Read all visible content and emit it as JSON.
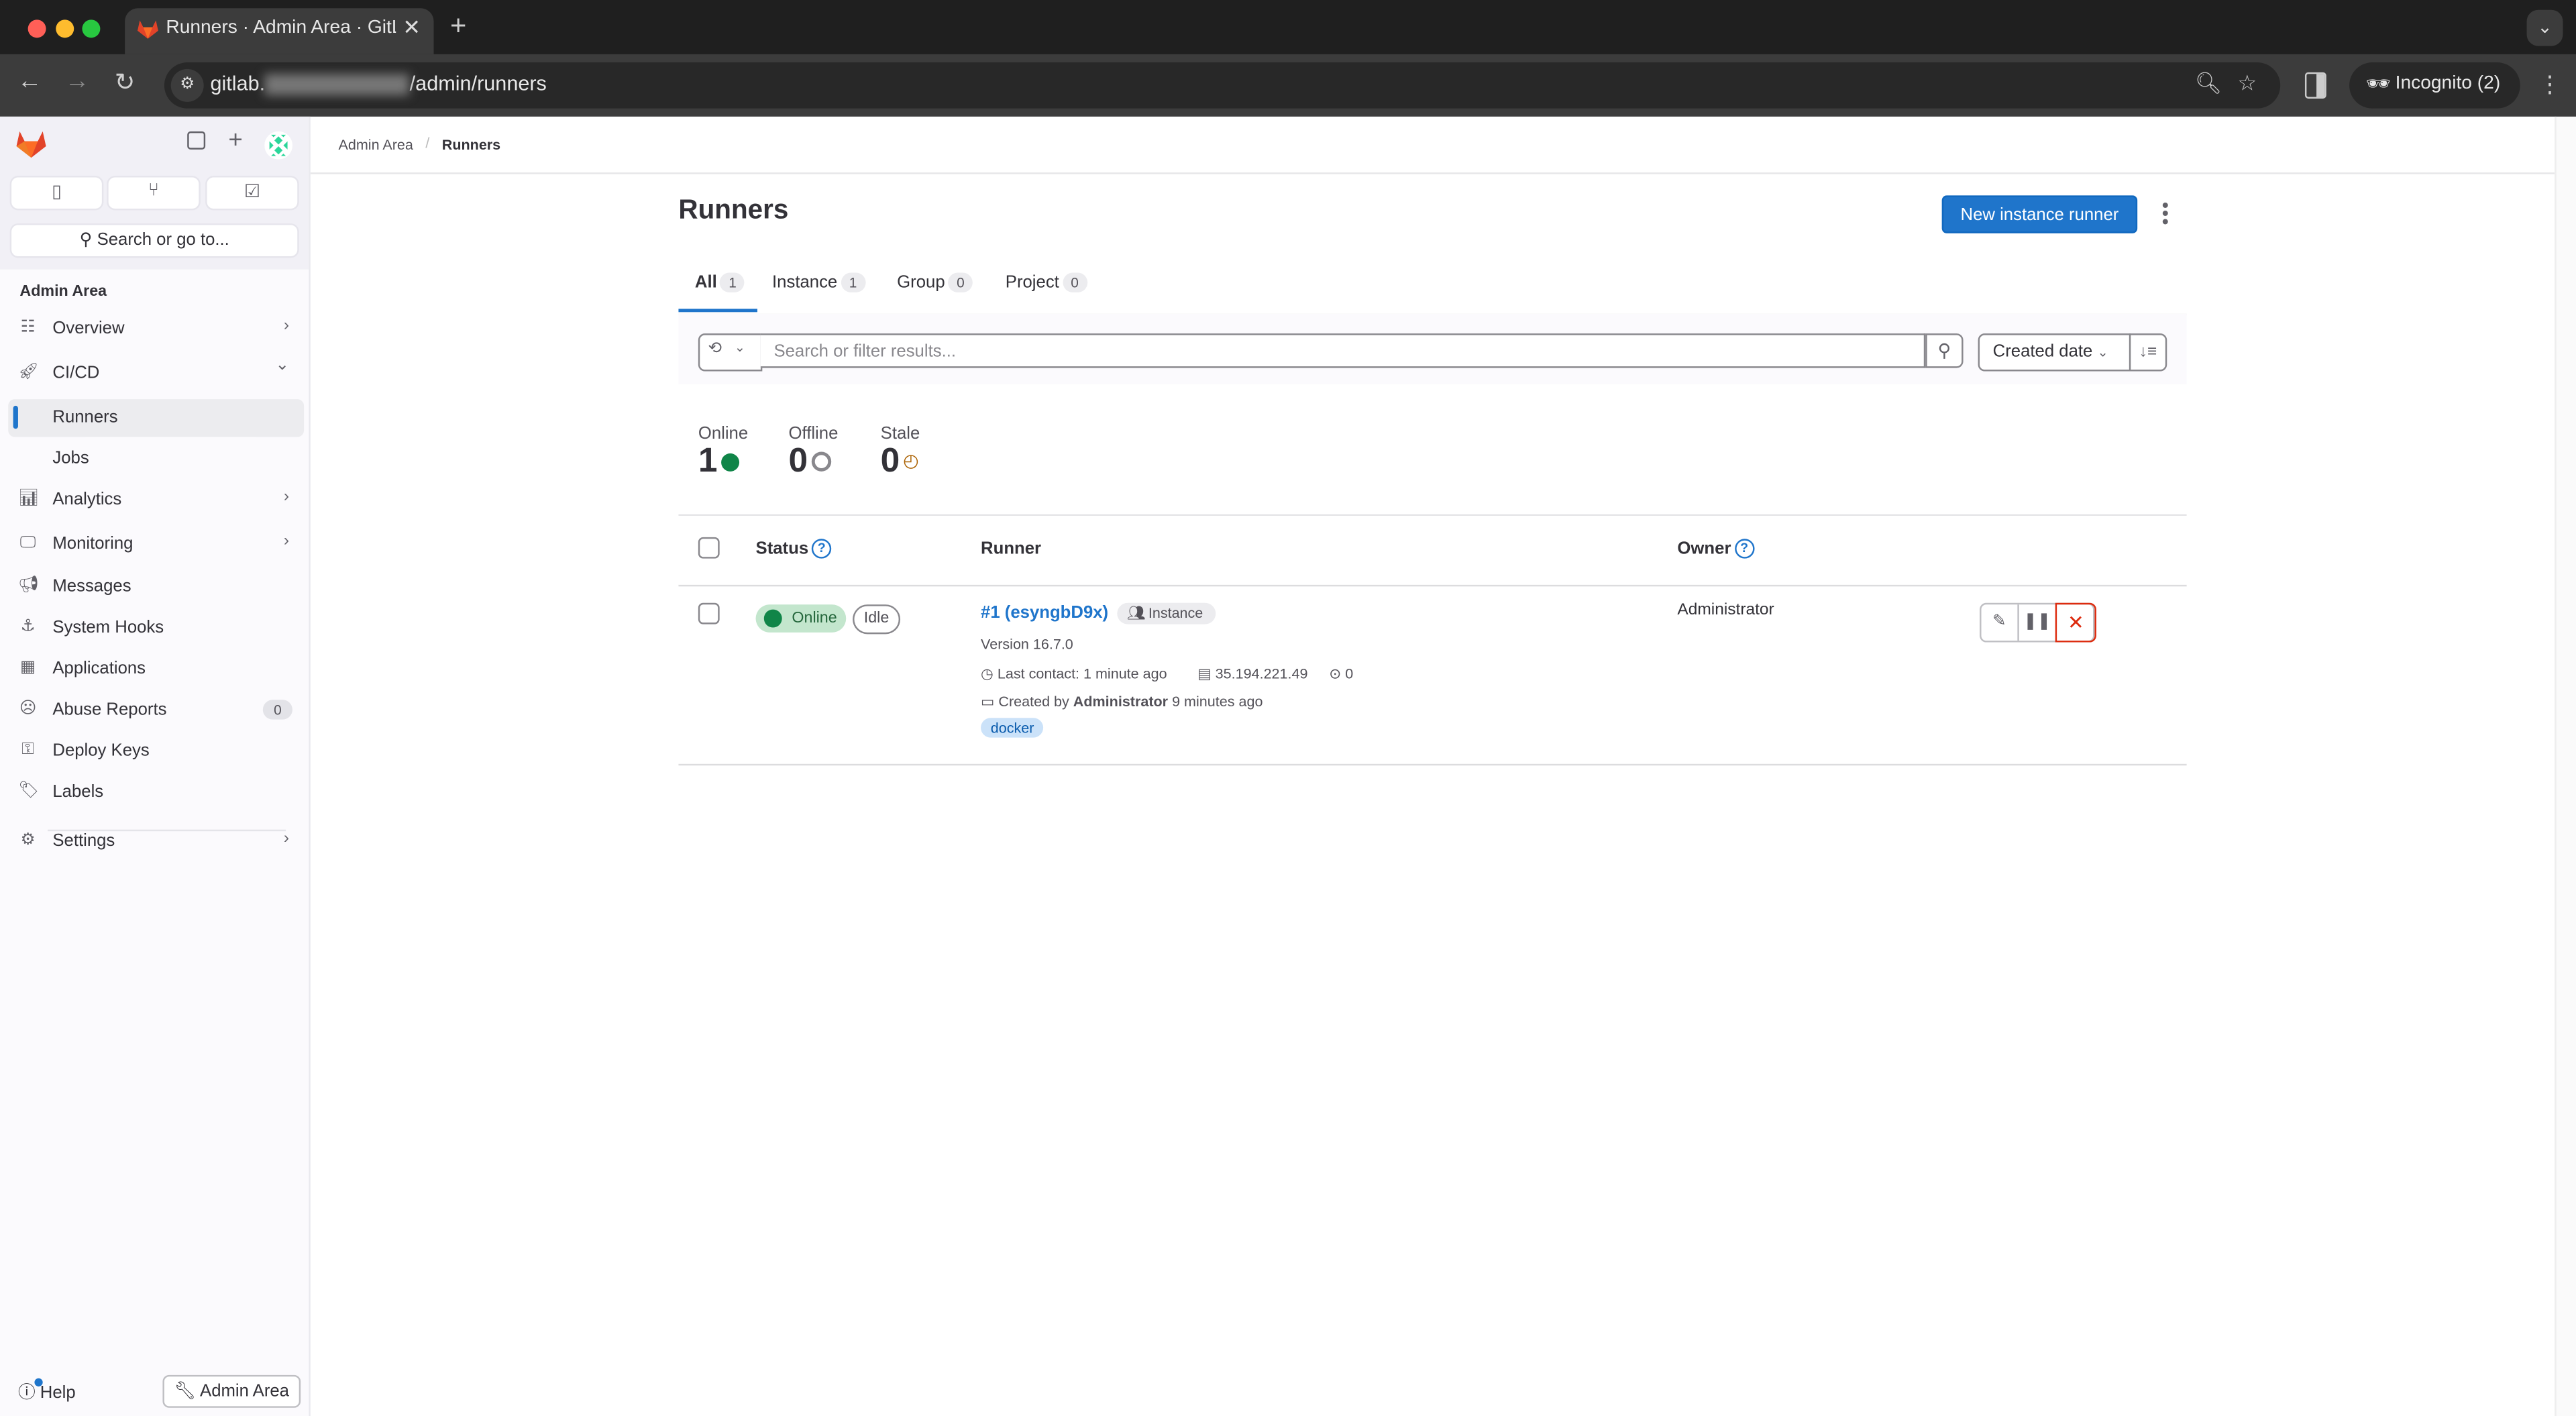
{
  "browser": {
    "tab_title": "Runners · Admin Area · GitLab",
    "url_prefix": "gitlab.",
    "url_path": "/admin/runners",
    "incognito_label": "Incognito (2)"
  },
  "sidebar": {
    "search_placeholder": "Search or go to...",
    "section_title": "Admin Area",
    "items": [
      {
        "label": "Overview",
        "icon": "overview-icon",
        "chevron": "›"
      },
      {
        "label": "CI/CD",
        "icon": "rocket-icon",
        "chevron": "⌄"
      },
      {
        "label": "Runners",
        "active": true
      },
      {
        "label": "Jobs"
      },
      {
        "label": "Analytics",
        "icon": "chart-icon",
        "chevron": "›"
      },
      {
        "label": "Monitoring",
        "icon": "monitor-icon",
        "chevron": "›"
      },
      {
        "label": "Messages",
        "icon": "megaphone-icon"
      },
      {
        "label": "System Hooks",
        "icon": "anchor-icon"
      },
      {
        "label": "Applications",
        "icon": "grid-icon"
      },
      {
        "label": "Abuse Reports",
        "icon": "frown-icon",
        "badge": "0"
      },
      {
        "label": "Deploy Keys",
        "icon": "key-icon"
      },
      {
        "label": "Labels",
        "icon": "label-icon"
      },
      {
        "label": "Settings",
        "icon": "gear-icon",
        "chevron": "›"
      }
    ],
    "help_label": "Help",
    "admin_area_label": "Admin Area"
  },
  "breadcrumb": {
    "items": [
      "Admin Area",
      "Runners"
    ]
  },
  "page": {
    "title": "Runners",
    "new_runner_label": "New instance runner",
    "tabs": [
      {
        "label": "All",
        "count": "1",
        "active": true
      },
      {
        "label": "Instance",
        "count": "1"
      },
      {
        "label": "Group",
        "count": "0"
      },
      {
        "label": "Project",
        "count": "0"
      }
    ],
    "search_placeholder": "Search or filter results...",
    "sort_label": "Created date",
    "stats": [
      {
        "label": "Online",
        "value": "1",
        "color": "#108548"
      },
      {
        "label": "Offline",
        "value": "0",
        "color": "#89888d"
      },
      {
        "label": "Stale",
        "value": "0",
        "color": "#ab6100"
      }
    ],
    "table": {
      "headers": {
        "status": "Status",
        "runner": "Runner",
        "owner": "Owner"
      },
      "rows": [
        {
          "status": "Online",
          "state": "Idle",
          "runner_name": "#1 (esyngbD9x)",
          "type_badge": "Instance",
          "version": "Version 16.7.0",
          "last_contact": "Last contact: 1 minute ago",
          "ip": "35.194.221.49",
          "jobs": "0",
          "created_prefix": "Created by",
          "created_by": "Administrator",
          "created_ago": "9 minutes ago",
          "tag": "docker",
          "owner": "Administrator"
        }
      ]
    }
  },
  "colors": {
    "accent": "#1f75cb",
    "online": "#108548",
    "danger": "#dd2b0e",
    "stale": "#ab6100"
  }
}
